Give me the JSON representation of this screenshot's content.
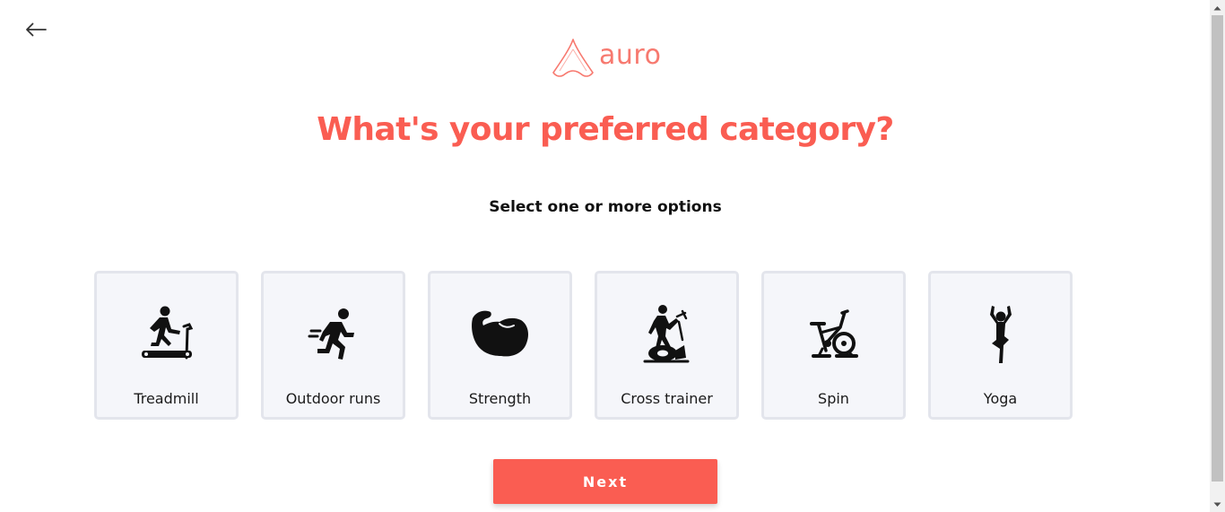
{
  "header": {
    "back_icon": "arrow-left-icon",
    "logo_text": "auro",
    "logo_icon": "auro-triangle-icon",
    "brand_color": "#fa5d52"
  },
  "main": {
    "title": "What's your preferred category?",
    "subtitle": "Select one or more options",
    "categories": [
      {
        "label": "Treadmill",
        "icon": "treadmill-icon"
      },
      {
        "label": "Outdoor runs",
        "icon": "runner-icon"
      },
      {
        "label": "Strength",
        "icon": "flexed-bicep-icon"
      },
      {
        "label": "Cross trainer",
        "icon": "elliptical-icon"
      },
      {
        "label": "Spin",
        "icon": "spin-bike-icon"
      },
      {
        "label": "Yoga",
        "icon": "yoga-pose-icon"
      }
    ],
    "next_label": "Next"
  }
}
